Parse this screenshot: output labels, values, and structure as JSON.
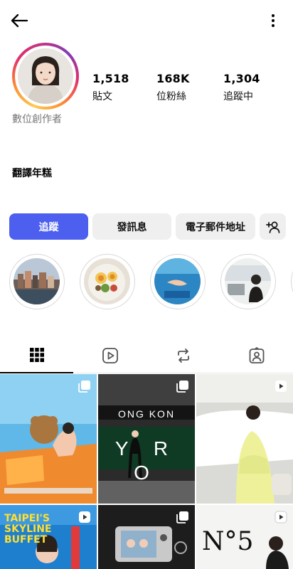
{
  "profile": {
    "category": "數位創作者",
    "name": "翻譯年糕",
    "stats": [
      {
        "count": "1,518",
        "label": "貼文"
      },
      {
        "count": "168K",
        "label": "位粉絲"
      },
      {
        "count": "1,304",
        "label": "追蹤中"
      }
    ]
  },
  "actions": {
    "follow_label": "追蹤",
    "message_label": "發訊息",
    "email_label": "電子郵件地址"
  },
  "highlights_count": 4,
  "tabs": [
    {
      "icon": "grid-icon",
      "active": true
    },
    {
      "icon": "reels-icon",
      "active": false
    },
    {
      "icon": "reposts-icon",
      "active": false
    },
    {
      "icon": "tagged-icon",
      "active": false
    }
  ],
  "posts": [
    {
      "type": "multi-photo",
      "text": ""
    },
    {
      "type": "multi-photo",
      "text": "ONG KON  Y R O"
    },
    {
      "type": "reel",
      "text": ""
    },
    {
      "type": "reel",
      "text": "TAIPEI'S SKYLINE BUFFET"
    },
    {
      "type": "multi-photo",
      "text": ""
    },
    {
      "type": "reel",
      "text": "N°5"
    }
  ],
  "colors": {
    "follow_button": "#4c5fef",
    "secondary_button": "#efefef",
    "category_text": "#777777"
  }
}
